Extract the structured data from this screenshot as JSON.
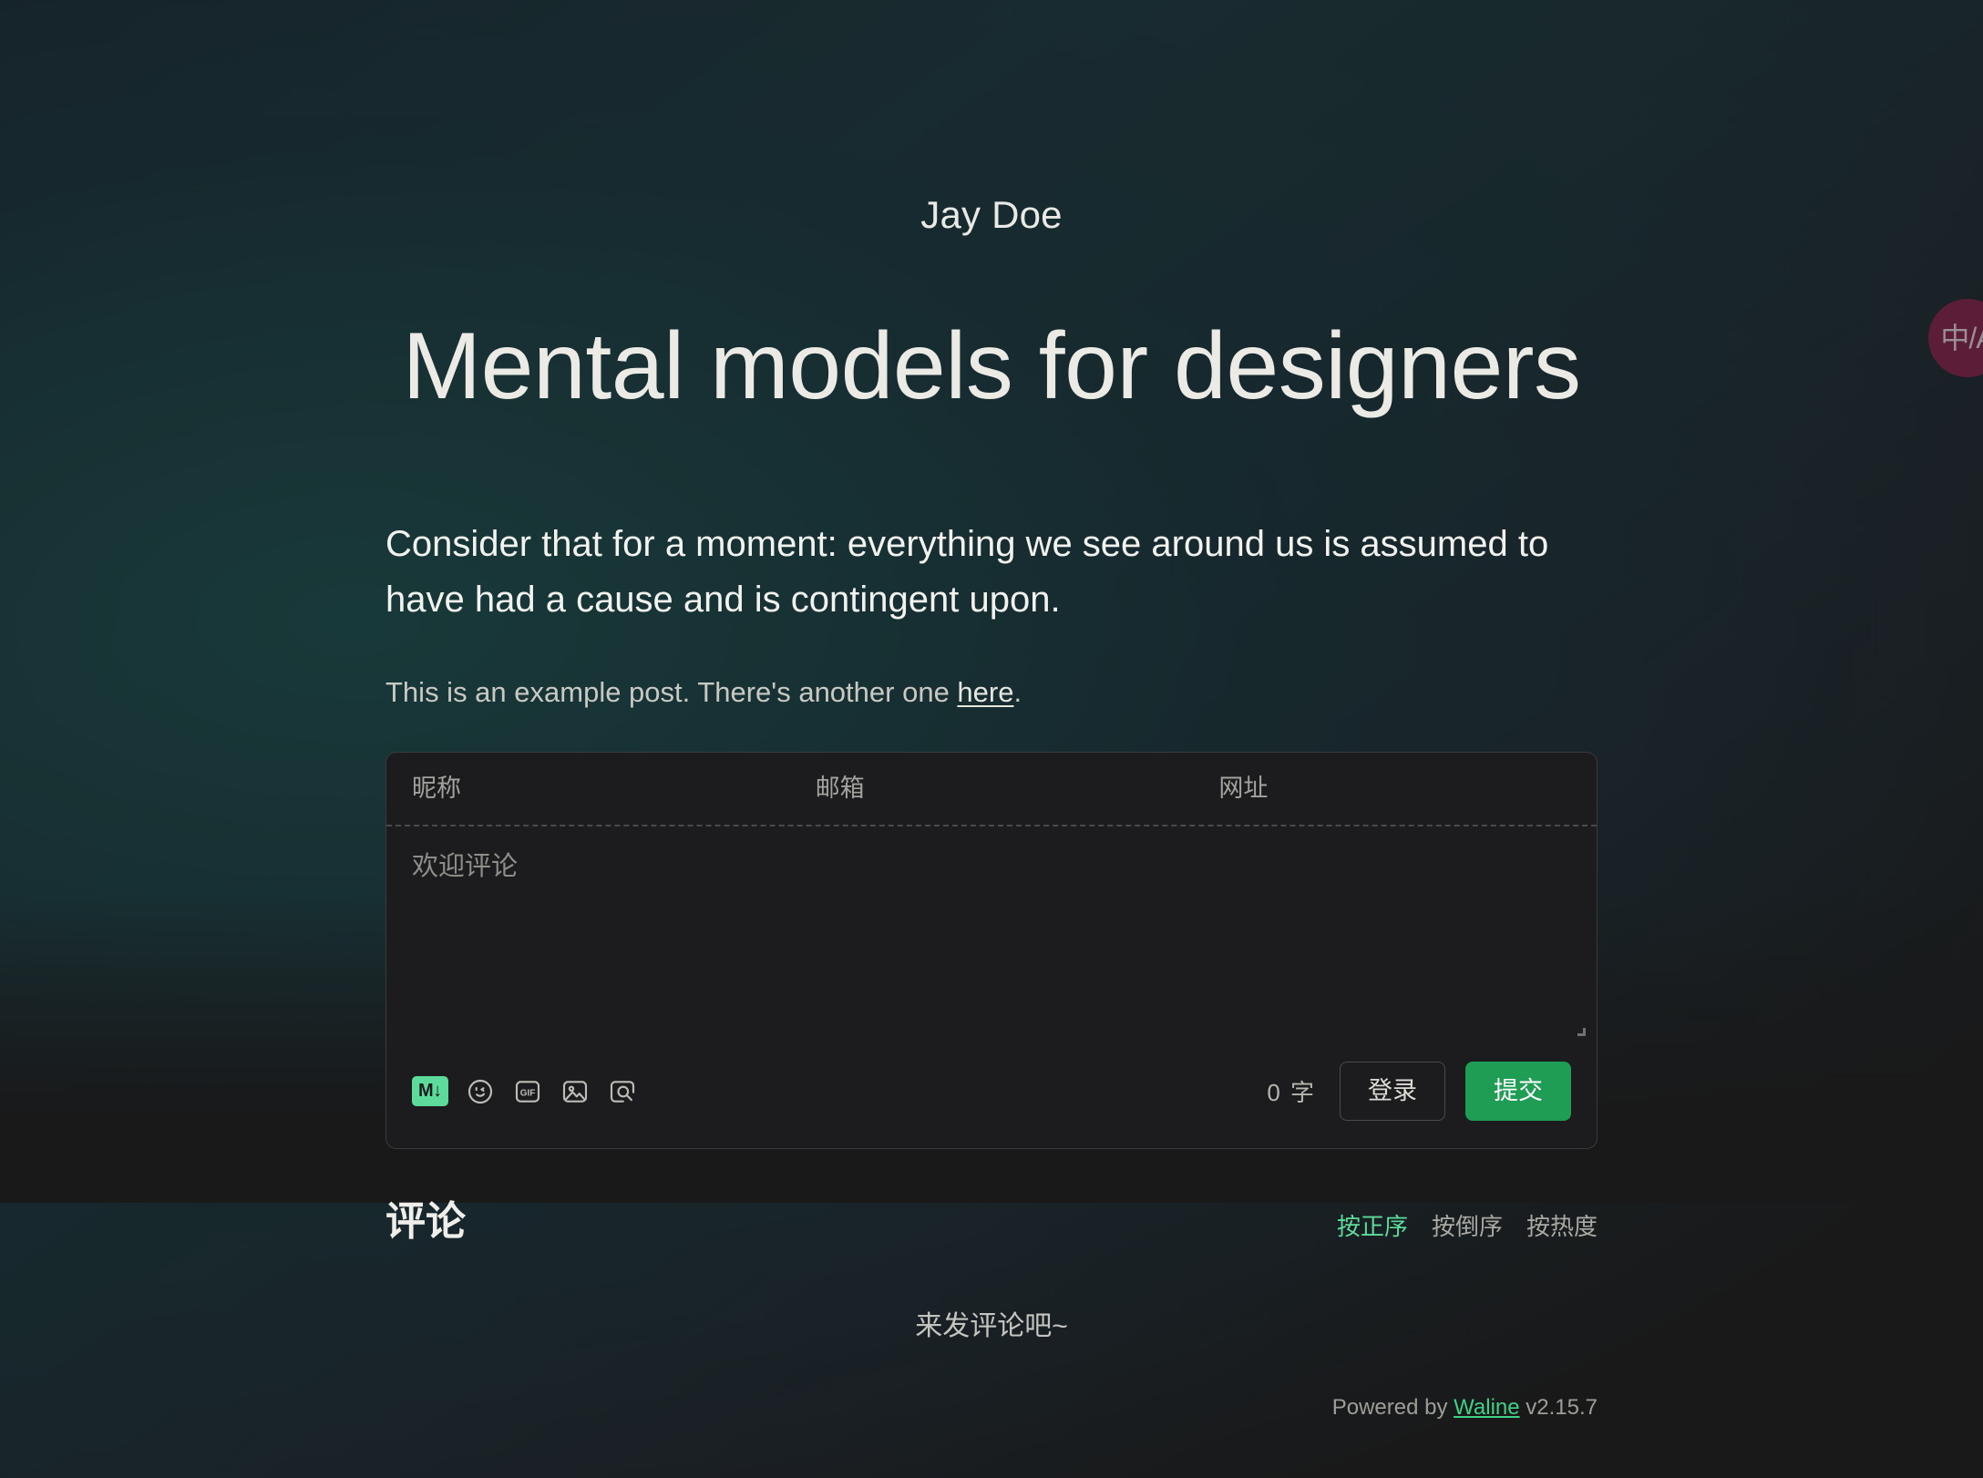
{
  "header": {
    "author": "Jay Doe",
    "title": "Mental models for designers"
  },
  "article": {
    "lead": "Consider that for a moment: everything we see around us is assumed to have had a cause and is contingent upon.",
    "note_prefix": "This is an example post. There's another one ",
    "note_link": "here",
    "note_suffix": "."
  },
  "comment_form": {
    "nickname_placeholder": "昵称",
    "email_placeholder": "邮箱",
    "website_placeholder": "网址",
    "editor_placeholder": "欢迎评论",
    "markdown_badge": "M↓",
    "gif_badge": "GIF",
    "wordcount": "0 字",
    "login_label": "登录",
    "submit_label": "提交"
  },
  "comments": {
    "title": "评论",
    "sorts": [
      {
        "label": "按正序",
        "active": true
      },
      {
        "label": "按倒序",
        "active": false
      },
      {
        "label": "按热度",
        "active": false
      }
    ],
    "empty_text": "来发评论吧~"
  },
  "footer": {
    "powered_prefix": "Powered by ",
    "brand": "Waline",
    "version": " v2.15.7"
  },
  "floating": {
    "lang_label": "中/A"
  },
  "colors": {
    "accent_green": "#5ddb9b",
    "submit_green": "#1f9d55",
    "page_bg": "#19191a",
    "lang_pill": "#5c1d38"
  }
}
